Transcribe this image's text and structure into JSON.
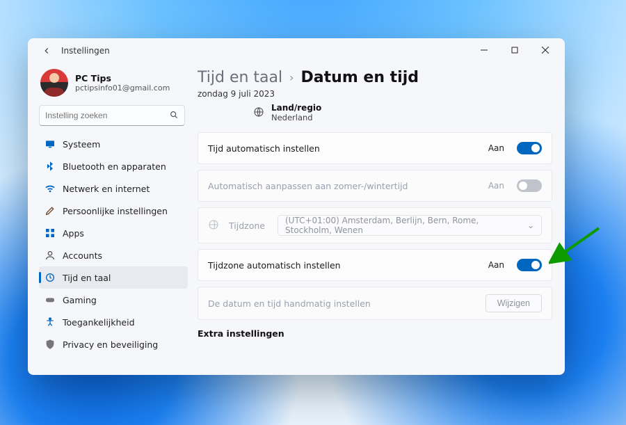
{
  "window": {
    "title": "Instellingen"
  },
  "profile": {
    "name": "PC Tips",
    "email": "pctipsinfo01@gmail.com"
  },
  "search": {
    "placeholder": "Instelling zoeken"
  },
  "sidebar": {
    "items": [
      {
        "label": "Systeem"
      },
      {
        "label": "Bluetooth en apparaten"
      },
      {
        "label": "Netwerk en internet"
      },
      {
        "label": "Persoonlijke instellingen"
      },
      {
        "label": "Apps"
      },
      {
        "label": "Accounts"
      },
      {
        "label": "Tijd en taal"
      },
      {
        "label": "Gaming"
      },
      {
        "label": "Toegankelijkheid"
      },
      {
        "label": "Privacy en beveiliging"
      }
    ]
  },
  "crumbs": {
    "parent": "Tijd en taal",
    "current": "Datum en tijd"
  },
  "dateline": "zondag 9 juli 2023",
  "region": {
    "label": "Land/regio",
    "value": "Nederland"
  },
  "rows": {
    "auto_time": {
      "label": "Tijd automatisch instellen",
      "status": "Aan"
    },
    "dst": {
      "label": "Automatisch aanpassen aan zomer-/wintertijd",
      "status": "Aan"
    },
    "tz": {
      "label": "Tijdzone",
      "value": "(UTC+01:00) Amsterdam, Berlijn, Bern, Rome, Stockholm, Wenen"
    },
    "auto_tz": {
      "label": "Tijdzone automatisch instellen",
      "status": "Aan"
    },
    "manual": {
      "label": "De datum en tijd handmatig instellen",
      "button": "Wijzigen"
    }
  },
  "extra_title": "Extra instellingen"
}
